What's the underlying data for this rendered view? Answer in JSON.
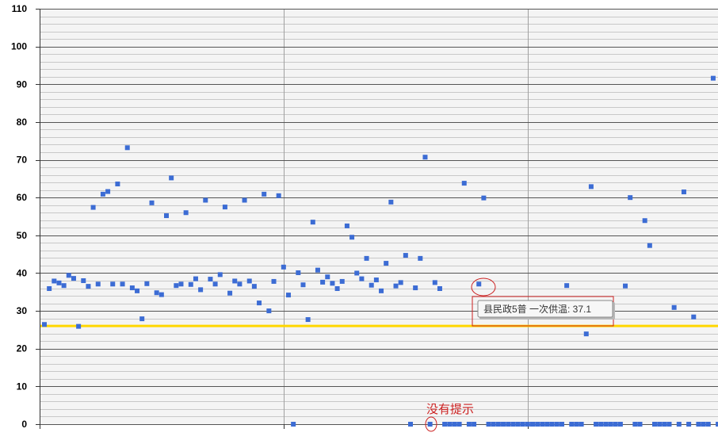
{
  "chart_data": {
    "type": "scatter",
    "title": "",
    "xlabel": "",
    "ylabel": "",
    "ylim": [
      0,
      110
    ],
    "yticks": [
      0,
      10,
      20,
      30,
      40,
      50,
      60,
      70,
      80,
      90,
      100,
      110
    ],
    "grid": true,
    "minor_grid_step": 2,
    "reference_line": {
      "y": 26,
      "color": "#ffd700"
    },
    "marker_color": "#3c6cd4",
    "series": [
      {
        "values": [
          26.4,
          35.9,
          37.9,
          37.4,
          36.7,
          39.4,
          38.6,
          25.9,
          38.0,
          36.5,
          57.4,
          37.1,
          60.9,
          61.6,
          37.1,
          63.6,
          37.1,
          73.2,
          36.1,
          35.3,
          27.9,
          37.2,
          58.6,
          34.8,
          34.3,
          55.2,
          65.2,
          36.7,
          37.1,
          56.0,
          37.0,
          38.5,
          35.6,
          59.3,
          38.4,
          37.1,
          39.6,
          57.5,
          34.7,
          37.9,
          37.1,
          59.3,
          37.9,
          36.5,
          32.1,
          60.9,
          30.0,
          37.8,
          60.5,
          41.6,
          34.2,
          0,
          40.1,
          36.9,
          27.7,
          53.5,
          40.8,
          37.6,
          39.0,
          37.3,
          35.9,
          37.8,
          52.5,
          49.5,
          40.0,
          38.5,
          43.9,
          36.8,
          38.2,
          35.3,
          42.6,
          58.8,
          36.6,
          37.5,
          44.7,
          0,
          36.1,
          43.9,
          70.7,
          0,
          37.5,
          35.9,
          0,
          0,
          0,
          0,
          63.8,
          0,
          0,
          37.1,
          59.9,
          0,
          0,
          0,
          0,
          0,
          0,
          0,
          0,
          0,
          0,
          0,
          0,
          0,
          0,
          0,
          0,
          36.7,
          0,
          0,
          0,
          23.9,
          62.9,
          0,
          0,
          0,
          0,
          0,
          0,
          36.6,
          60.0,
          0,
          0,
          53.9,
          47.3,
          0,
          0,
          0,
          0,
          30.9,
          0,
          61.5,
          0,
          28.4,
          0,
          0,
          0,
          91.6,
          0
        ]
      }
    ],
    "tooltip": "县民政5普 一次供温: 37.1",
    "annotation": "没有提示"
  }
}
